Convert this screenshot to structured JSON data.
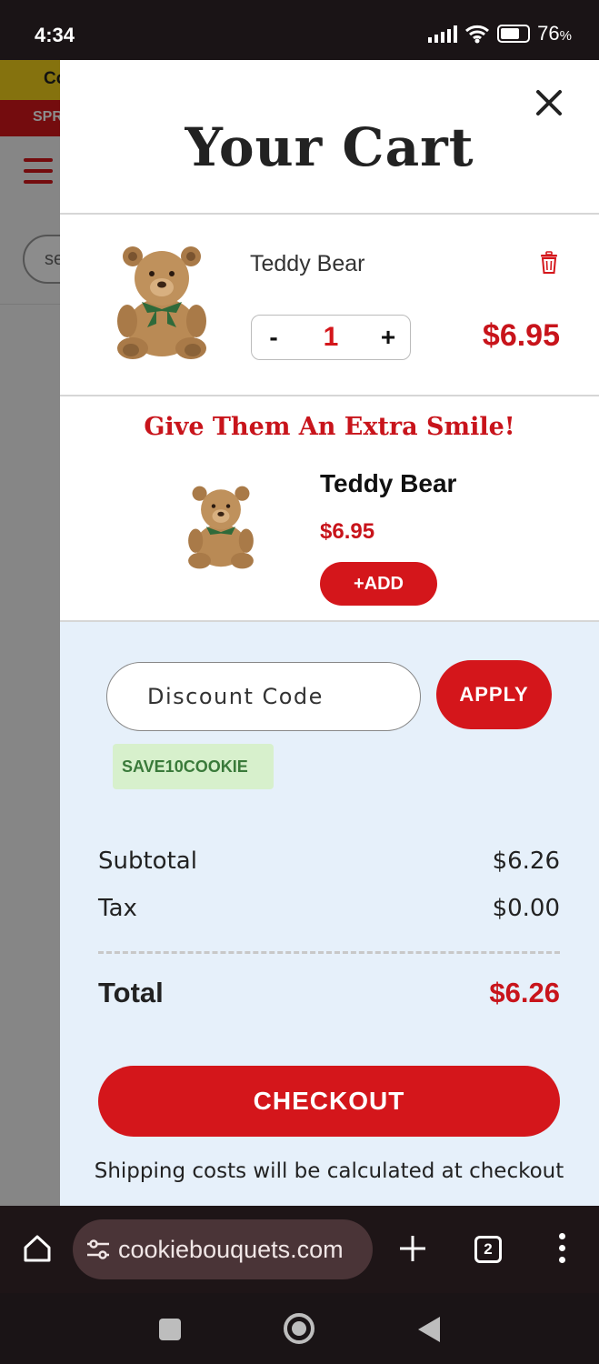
{
  "status_bar": {
    "time": "4:34",
    "battery": "76",
    "battery_suffix": "%",
    "icons": [
      "signal-icon",
      "wifi-icon",
      "battery-icon"
    ]
  },
  "background_page": {
    "promo_text": "Co",
    "banner_text": "SPR",
    "search_placeholder": "se"
  },
  "cart": {
    "title": "Your Cart",
    "item": {
      "name": "Teddy Bear",
      "quantity": "1",
      "minus_label": "-",
      "plus_label": "+",
      "price": "$6.95"
    },
    "upsell": {
      "title": "Give Them An Extra Smile!",
      "name": "Teddy Bear",
      "price": "$6.95",
      "add_label": "+ADD"
    },
    "discount": {
      "placeholder": "Discount Code",
      "apply_label": "APPLY",
      "applied_code": "SAVE10COOKIE"
    },
    "summary": {
      "subtotal_label": "Subtotal",
      "subtotal_value": "$6.26",
      "tax_label": "Tax",
      "tax_value": "$0.00",
      "total_label": "Total",
      "total_value": "$6.26"
    },
    "checkout_label": "CHECKOUT",
    "shipping_note": "Shipping costs will be calculated at checkout"
  },
  "browser": {
    "url": "cookiebouquets.com",
    "tab_count": "2"
  },
  "colors": {
    "brand_red": "#d4161b",
    "price_red": "#c8141b",
    "summary_bg": "#e6f0fa",
    "code_tag_bg": "#d7f0cc"
  }
}
